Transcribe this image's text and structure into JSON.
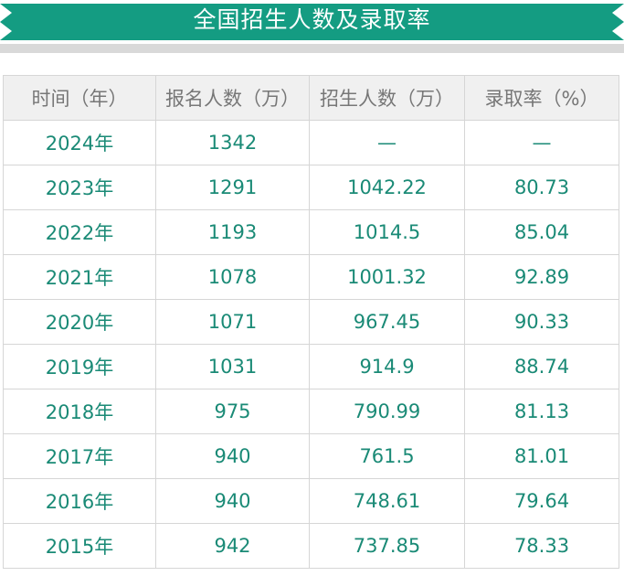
{
  "banner": {
    "title": "全国招生人数及录取率",
    "color": "#149c82",
    "band_color": "#d9d9d9"
  },
  "table": {
    "headers": [
      "时间（年）",
      "报名人数（万）",
      "招生人数（万）",
      "录取率（%）"
    ],
    "rows": [
      [
        "2024年",
        "1342",
        "—",
        "—"
      ],
      [
        "2023年",
        "1291",
        "1042.22",
        "80.73"
      ],
      [
        "2022年",
        "1193",
        "1014.5",
        "85.04"
      ],
      [
        "2021年",
        "1078",
        "1001.32",
        "92.89"
      ],
      [
        "2020年",
        "1071",
        "967.45",
        "90.33"
      ],
      [
        "2019年",
        "1031",
        "914.9",
        "88.74"
      ],
      [
        "2018年",
        "975",
        "790.99",
        "81.13"
      ],
      [
        "2017年",
        "940",
        "761.5",
        "81.01"
      ],
      [
        "2016年",
        "940",
        "748.61",
        "79.64"
      ],
      [
        "2015年",
        "942",
        "737.85",
        "78.33"
      ]
    ],
    "text_color": "#1a8a76",
    "header_bg": "#f0f0f0"
  }
}
